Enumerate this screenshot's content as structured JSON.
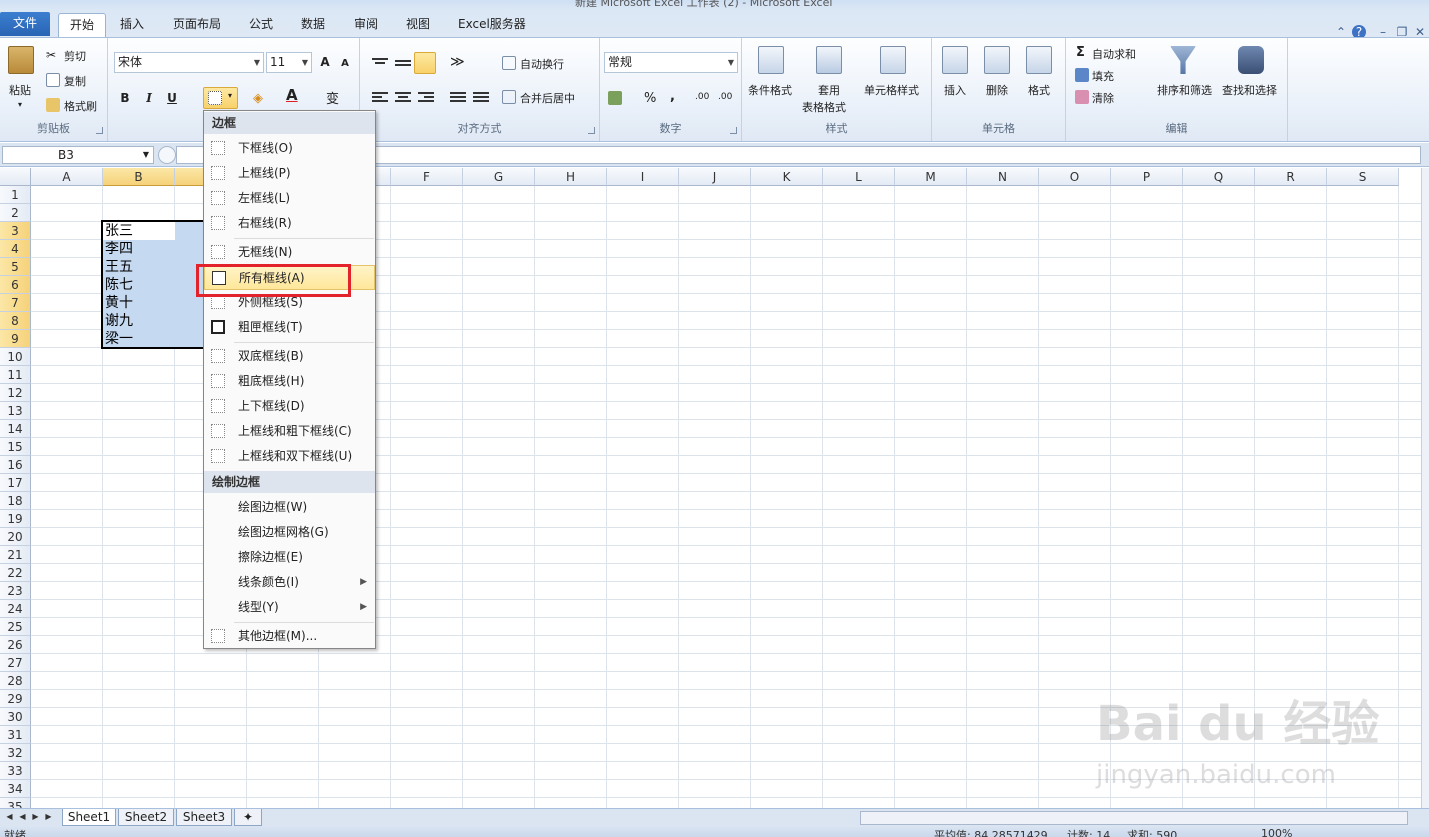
{
  "window": {
    "title": "新建 Microsoft Excel 工作表 (2) - Microsoft Excel"
  },
  "tabs": [
    "文件",
    "开始",
    "插入",
    "页面布局",
    "公式",
    "数据",
    "审阅",
    "视图",
    "Excel服务器"
  ],
  "ribbon": {
    "clipboard": {
      "label": "剪贴板",
      "paste": "粘贴",
      "cut": "剪切",
      "copy": "复制",
      "format_painter": "格式刷"
    },
    "font": {
      "name": "宋体",
      "size": "11",
      "bold": "B",
      "italic": "I",
      "underline": "U",
      "increase": "A",
      "decrease": "A"
    },
    "alignment": {
      "label": "对齐方式",
      "wrap": "自动换行",
      "merge": "合并后居中"
    },
    "number": {
      "label": "数字",
      "format": "常规",
      "percent": "%",
      "comma": ","
    },
    "styles": {
      "label": "样式",
      "cond": "条件格式",
      "table1": "套用",
      "table2": "表格格式",
      "cellstyle": "单元格样式"
    },
    "cells": {
      "label": "单元格",
      "insert": "插入",
      "delete": "删除",
      "format": "格式"
    },
    "editing": {
      "label": "编辑",
      "autosum": "自动求和",
      "fill": "填充",
      "clear": "清除",
      "sort": "排序和筛选",
      "find": "查找和选择"
    }
  },
  "formula_bar": {
    "name_box": "B3"
  },
  "columns": [
    "A",
    "B",
    "C",
    "D",
    "E",
    "F",
    "G",
    "H",
    "I",
    "J",
    "K",
    "L",
    "M",
    "N",
    "O",
    "P",
    "Q",
    "R",
    "S"
  ],
  "rows": [
    "1",
    "2",
    "3",
    "4",
    "5",
    "6",
    "7",
    "8",
    "9",
    "10",
    "11",
    "12",
    "13",
    "14",
    "15",
    "16",
    "17",
    "18",
    "19",
    "20",
    "21",
    "22",
    "23",
    "24",
    "25",
    "26",
    "27",
    "28",
    "29",
    "30",
    "31",
    "32",
    "33",
    "34",
    "35"
  ],
  "cells": [
    "张三",
    "李四",
    "王五",
    "陈七",
    "黄十",
    "谢九",
    "梁一"
  ],
  "border_menu": {
    "header1": "边框",
    "items1": [
      "下框线(O)",
      "上框线(P)",
      "左框线(L)",
      "右框线(R)"
    ],
    "items2": [
      "无框线(N)",
      "所有框线(A)",
      "外侧框线(S)",
      "粗匣框线(T)"
    ],
    "items3": [
      "双底框线(B)",
      "粗底框线(H)",
      "上下框线(D)",
      "上框线和粗下框线(C)",
      "上框线和双下框线(U)"
    ],
    "header2": "绘制边框",
    "items4": [
      "绘图边框(W)",
      "绘图边框网格(G)",
      "擦除边框(E)",
      "线条颜色(I)",
      "线型(Y)"
    ],
    "items5": [
      "其他边框(M)..."
    ]
  },
  "sheets": [
    "Sheet1",
    "Sheet2",
    "Sheet3"
  ],
  "status": {
    "ready": "就绪",
    "average": "平均值: 84.28571429",
    "count": "计数: 14",
    "sum": "求和: 590",
    "zoom": "100%"
  },
  "watermark": {
    "brand": "Bai du 经验",
    "url": "jingyan.baidu.com"
  },
  "colors": {
    "highlight": "#e3232c",
    "selection": "#c5d9f1",
    "file_tab": "#2a64b4"
  }
}
